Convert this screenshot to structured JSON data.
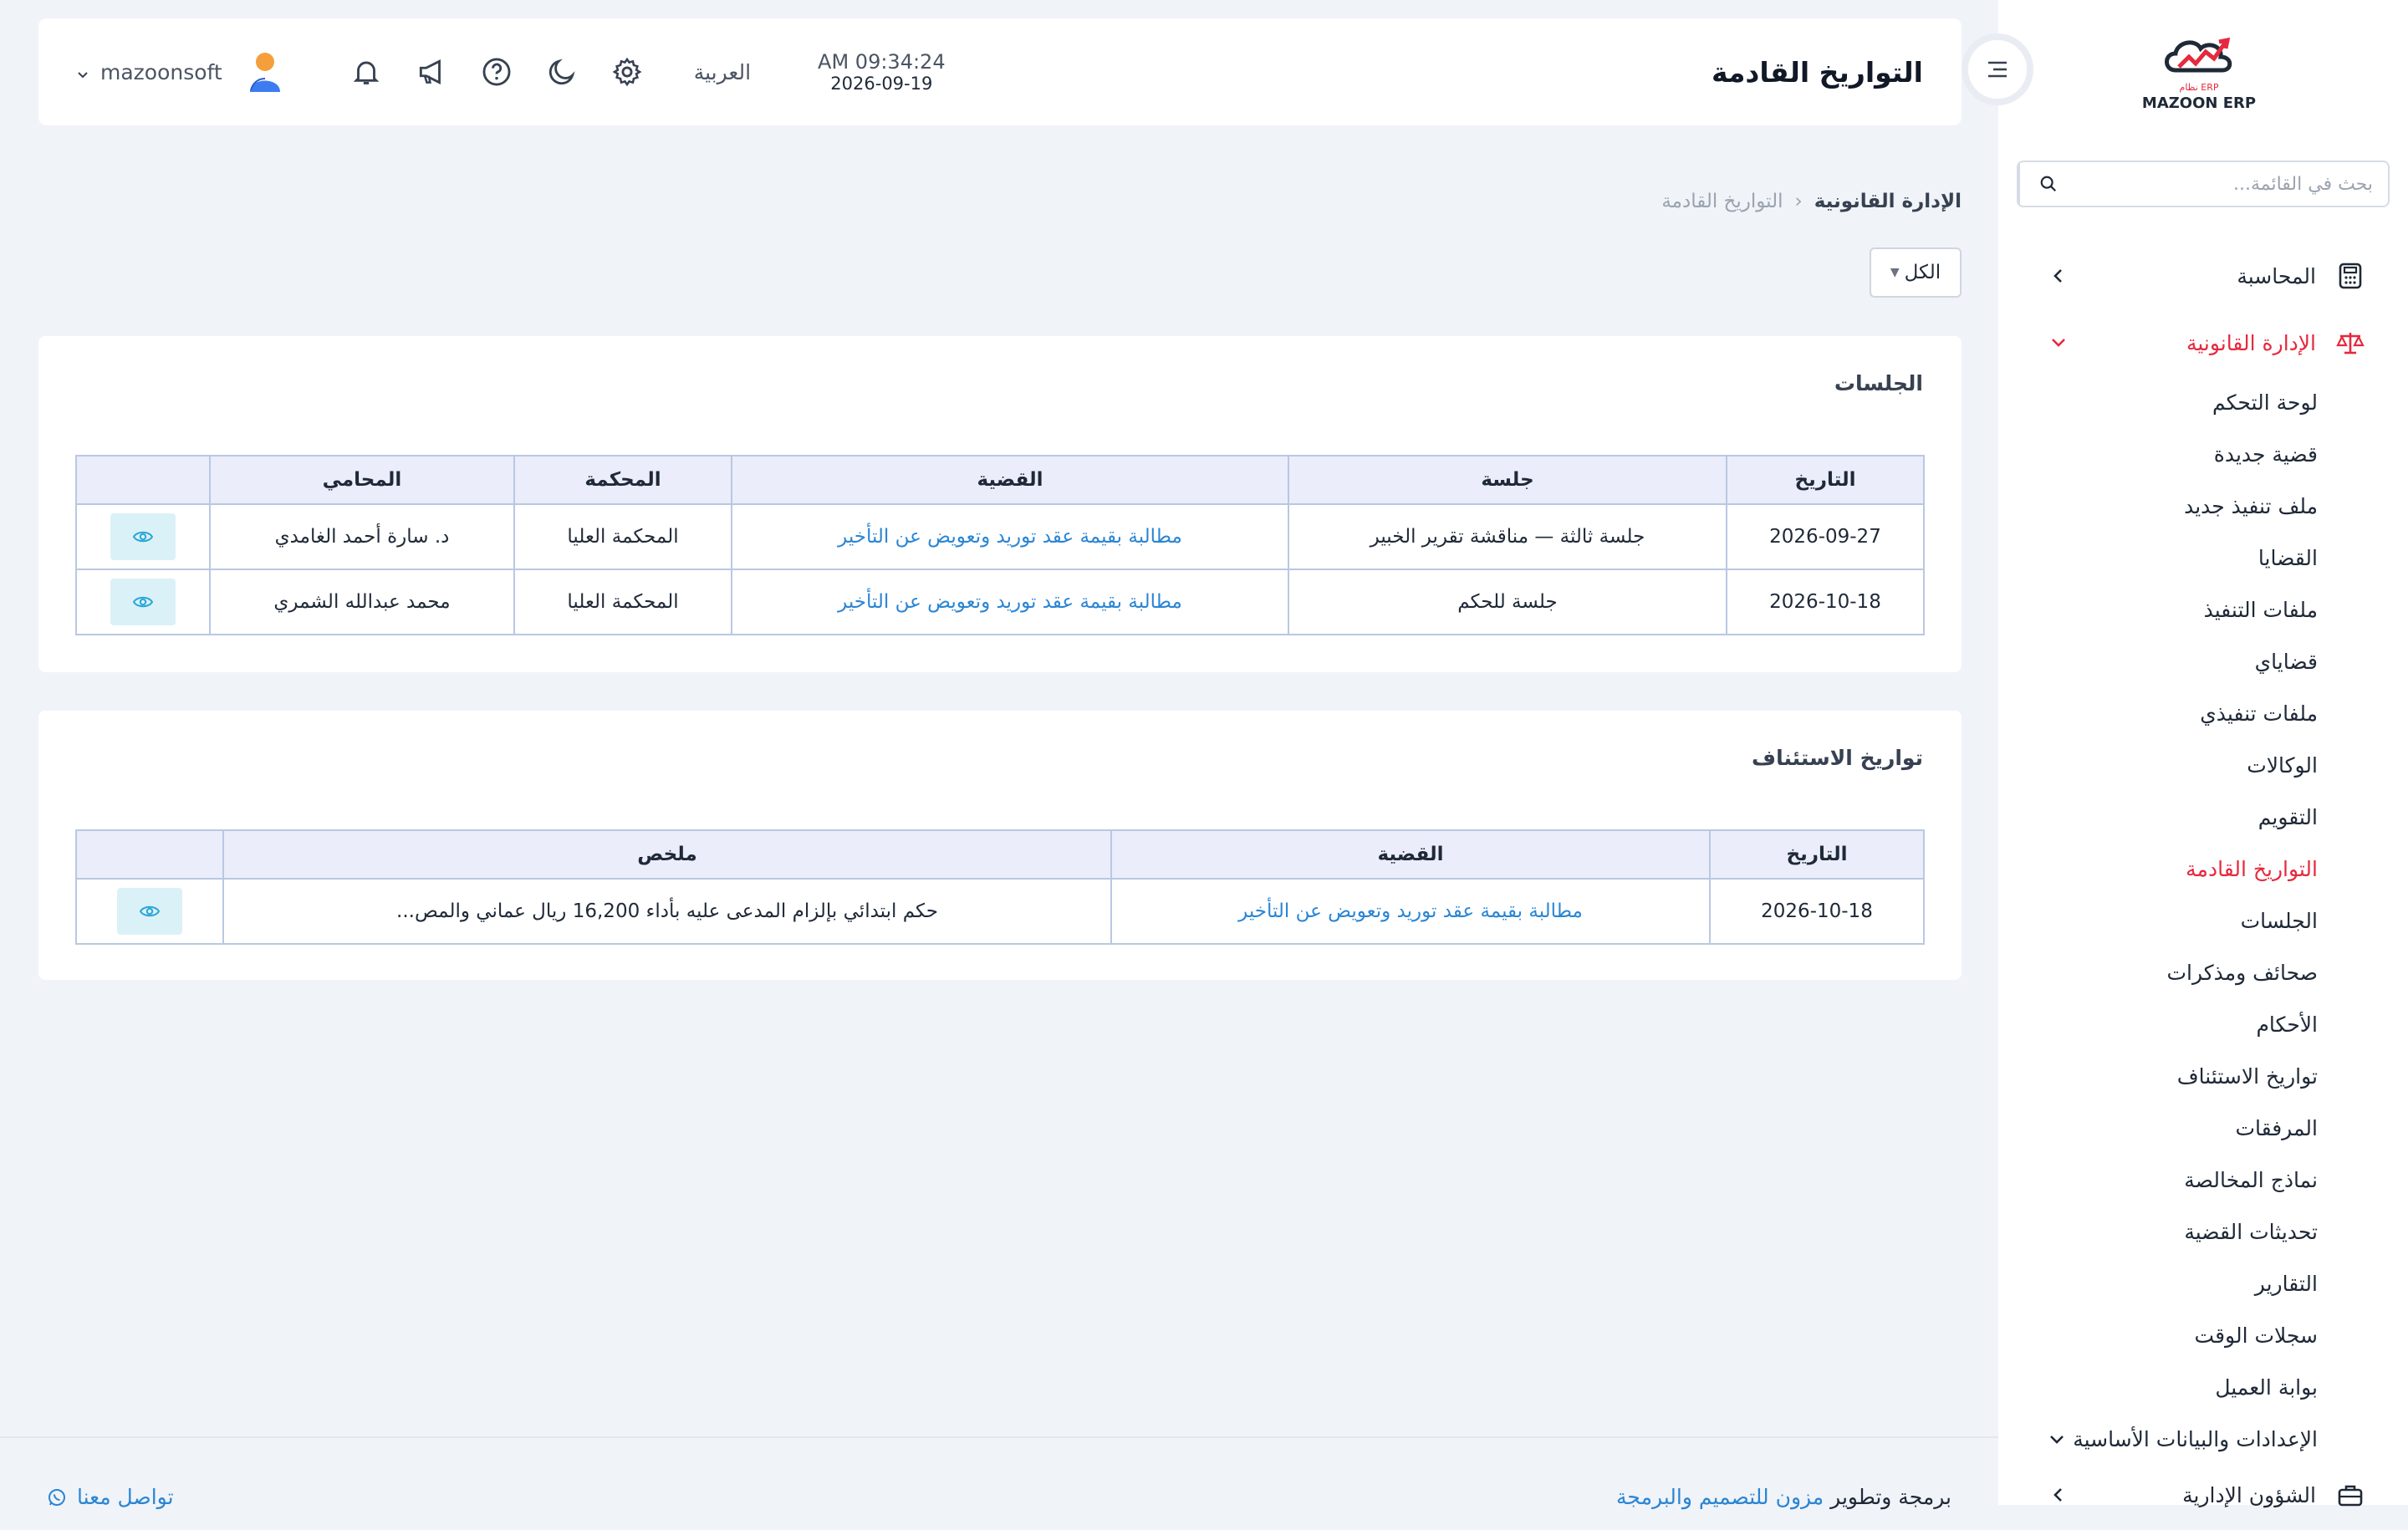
{
  "colors": {
    "accent": "#e5293e",
    "link": "#2a85d4",
    "table_header": "#ebedfb",
    "page_bg": "#f0f3f8"
  },
  "sidebar": {
    "logo_text": "MAZOON ERP",
    "logo_small": "ERP نظام",
    "search_placeholder": "بحث في القائمة...",
    "accounting": "المحاسبة",
    "legal": "الإدارة القانونية",
    "sub_items": [
      "لوحة التحكم",
      "قضية جديدة",
      "ملف تنفيذ جديد",
      "القضايا",
      "ملفات التنفيذ",
      "قضاياي",
      "ملفات تنفيذي",
      "الوكالات",
      "التقويم",
      "التواريخ القادمة",
      "الجلسات",
      "صحائف ومذكرات",
      "الأحكام",
      "تواريخ الاستئناف",
      "المرفقات",
      "نماذج المخالصة",
      "تحديثات القضية",
      "التقارير",
      "سجلات الوقت",
      "بوابة العميل"
    ],
    "settings_group": "الإعدادات والبيانات الأساسية",
    "admin_affairs": "الشؤون الإدارية"
  },
  "header": {
    "title": "التواريخ القادمة",
    "time": "AM 09:34:24",
    "date": "2026-09-19",
    "language": "العربية",
    "username": "mazoonsoft"
  },
  "breadcrumb": {
    "parent": "الإدارة القانونية",
    "current": "التواريخ القادمة"
  },
  "filter": {
    "selected": "الكل"
  },
  "sessions": {
    "title": "الجلسات",
    "columns": [
      "التاريخ",
      "جلسة",
      "القضية",
      "المحكمة",
      "المحامي",
      ""
    ],
    "rows": [
      {
        "date": "2026-09-27",
        "session": "جلسة ثالثة — مناقشة تقرير الخبير",
        "case": "مطالبة بقيمة عقد توريد وتعويض عن التأخير",
        "court": "المحكمة العليا",
        "lawyer": "د. سارة أحمد الغامدي"
      },
      {
        "date": "2026-10-18",
        "session": "جلسة للحكم",
        "case": "مطالبة بقيمة عقد توريد وتعويض عن التأخير",
        "court": "المحكمة العليا",
        "lawyer": "محمد عبدالله الشمري"
      }
    ]
  },
  "appeals": {
    "title": "تواريخ الاستئناف",
    "columns": [
      "التاريخ",
      "القضية",
      "ملخص",
      ""
    ],
    "rows": [
      {
        "date": "2026-10-18",
        "case": "مطالبة بقيمة عقد توريد وتعويض عن التأخير",
        "summary": "حكم ابتدائي بإلزام المدعى عليه بأداء 16,200 ريال عماني والمص..."
      }
    ]
  },
  "footer": {
    "credit_prefix": "برمجة وتطوير",
    "credit_link": "مزون للتصميم والبرمجة",
    "contact": "تواصل معنا"
  }
}
